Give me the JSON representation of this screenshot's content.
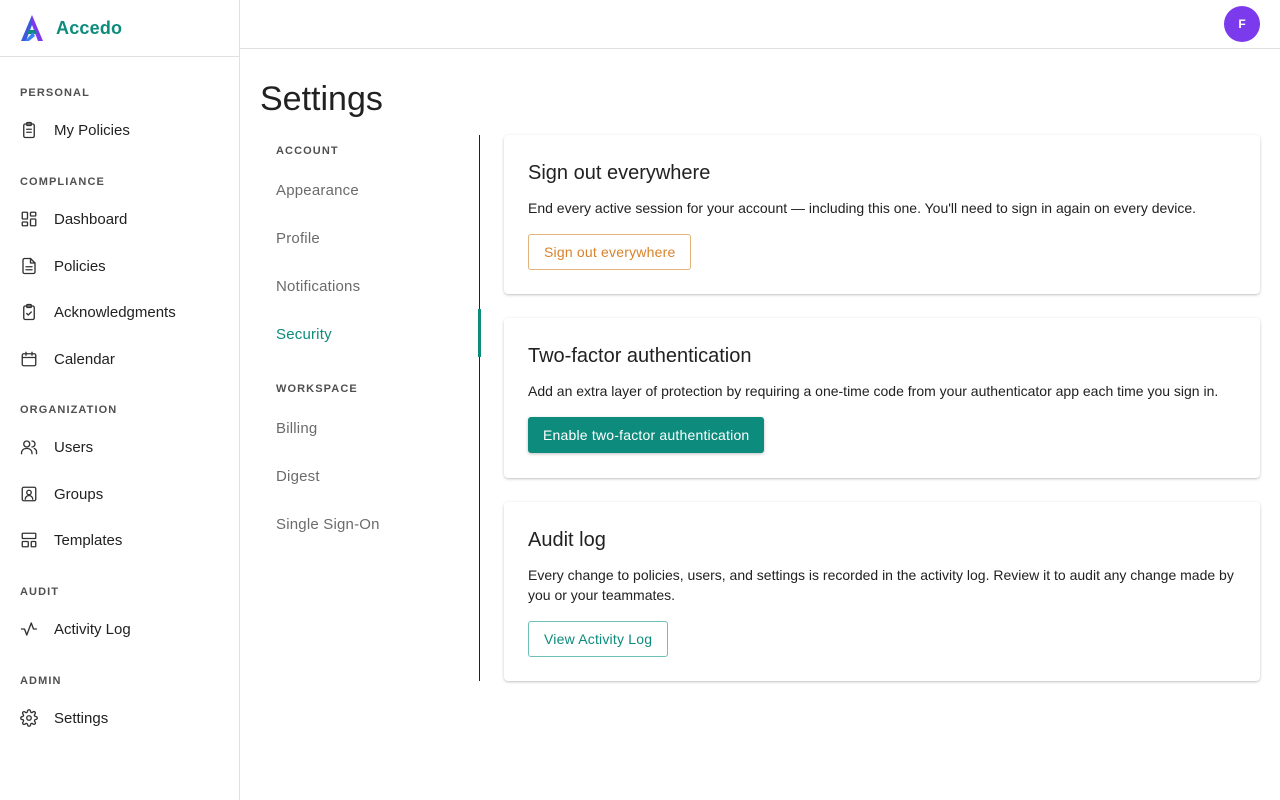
{
  "brand": {
    "name": "Accedo"
  },
  "user": {
    "avatar_initial": "F"
  },
  "sidebar": {
    "sections": [
      {
        "heading": "PERSONAL",
        "items": [
          {
            "label": "My Policies",
            "icon": "clipboard-icon"
          }
        ]
      },
      {
        "heading": "COMPLIANCE",
        "items": [
          {
            "label": "Dashboard",
            "icon": "dashboard-icon"
          },
          {
            "label": "Policies",
            "icon": "document-icon"
          },
          {
            "label": "Acknowledgments",
            "icon": "clipboard-check-icon"
          },
          {
            "label": "Calendar",
            "icon": "calendar-icon"
          }
        ]
      },
      {
        "heading": "ORGANIZATION",
        "items": [
          {
            "label": "Users",
            "icon": "users-icon"
          },
          {
            "label": "Groups",
            "icon": "group-icon"
          },
          {
            "label": "Templates",
            "icon": "templates-icon"
          }
        ]
      },
      {
        "heading": "AUDIT",
        "items": [
          {
            "label": "Activity Log",
            "icon": "activity-icon"
          }
        ]
      },
      {
        "heading": "ADMIN",
        "items": [
          {
            "label": "Settings",
            "icon": "gear-icon"
          }
        ]
      }
    ]
  },
  "page": {
    "title": "Settings"
  },
  "settings_nav": {
    "account_heading": "ACCOUNT",
    "account_items": [
      "Appearance",
      "Profile",
      "Notifications",
      "Security"
    ],
    "workspace_heading": "WORKSPACE",
    "workspace_items": [
      "Billing",
      "Digest",
      "Single Sign-On"
    ],
    "active": "Security"
  },
  "cards": {
    "signout": {
      "title": "Sign out everywhere",
      "description": "End every active session for your account — including this one. You'll need to sign in again on every device.",
      "button": "Sign out everywhere"
    },
    "twofactor": {
      "title": "Two-factor authentication",
      "description": "Add an extra layer of protection by requiring a one-time code from your authenticator app each time you sign in.",
      "button": "Enable two-factor authentication"
    },
    "audit": {
      "title": "Audit log",
      "description": "Every change to policies, users, and settings is recorded in the activity log. Review it to audit any change made by you or your teammates.",
      "button": "View Activity Log"
    }
  },
  "colors": {
    "accent": "#0d8b7c",
    "warning": "#d9822b",
    "avatar": "#7c3aed"
  }
}
